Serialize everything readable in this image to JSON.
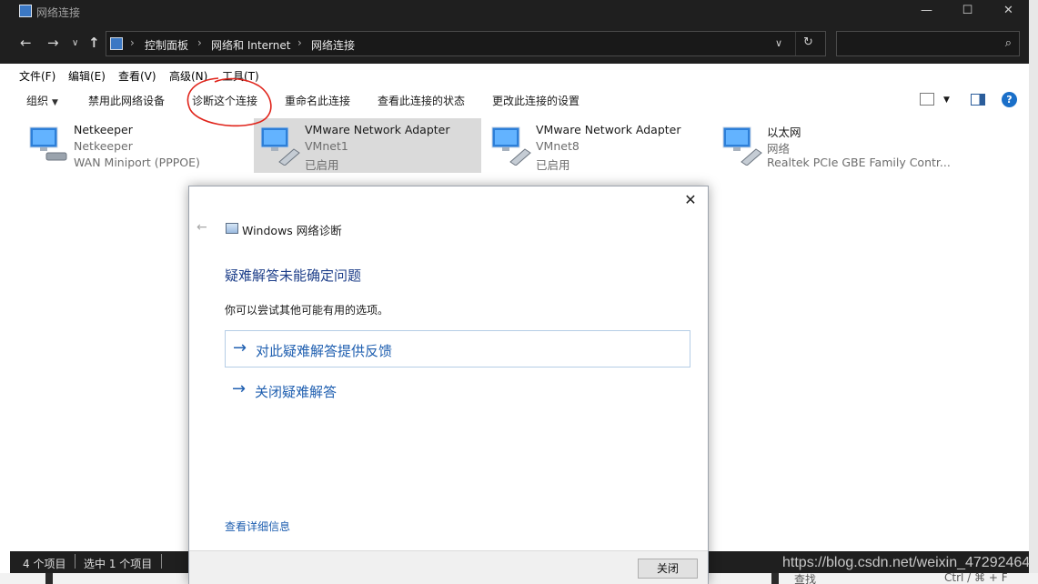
{
  "window": {
    "title": "网络连接",
    "controls": {
      "minimize": "—",
      "maximize": "☐",
      "close": "✕"
    }
  },
  "address": {
    "crumbs": [
      "控制面板",
      "网络和 Internet",
      "网络连接"
    ],
    "separator": "›",
    "search_placeholder": ""
  },
  "menu": [
    "文件(F)",
    "编辑(E)",
    "查看(V)",
    "高级(N)",
    "工具(T)"
  ],
  "commands": {
    "organize": "组织",
    "disable": "禁用此网络设备",
    "diagnose": "诊断这个连接",
    "rename": "重命名此连接",
    "view_status": "查看此连接的状态",
    "change_settings": "更改此连接的设置",
    "help": "?"
  },
  "connections": [
    {
      "name": "Netkeeper",
      "line2": "Netkeeper",
      "line3": "WAN Miniport (PPPOE)",
      "selected": false
    },
    {
      "name": "VMware Network Adapter",
      "line2": "VMnet1",
      "line3": "已启用",
      "selected": true
    },
    {
      "name": "VMware Network Adapter",
      "line2": "VMnet8",
      "line3": "已启用",
      "selected": false
    },
    {
      "name": "以太网",
      "line2": "网络",
      "line3": "Realtek PCIe GBE Family Contr...",
      "selected": false
    }
  ],
  "status": {
    "count": "4 个项目",
    "selected": "选中 1 个项目"
  },
  "dialog": {
    "title": "Windows 网络诊断",
    "heading": "疑难解答未能确定问题",
    "description": "你可以尝试其他可能有用的选项。",
    "options": [
      "对此疑难解答提供反馈",
      "关闭疑难解答"
    ],
    "details_link": "查看详细信息",
    "close_button": "关闭"
  },
  "background_fragments": {
    "find": "查找",
    "shortcut": "Ctrl / ⌘ + F"
  },
  "watermark": "https://blog.csdn.net/weixin_47292464",
  "colors": {
    "link_blue": "#1f5fb0",
    "heading_blue": "#1e3f8a",
    "annotation_red": "#e0241b"
  }
}
